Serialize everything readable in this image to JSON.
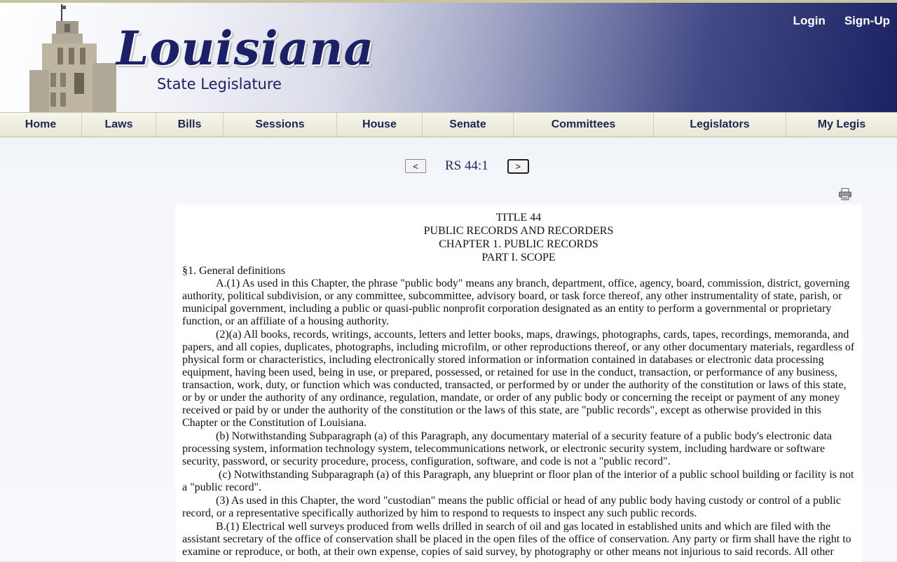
{
  "header": {
    "logo_title": "Louisiana",
    "logo_subtitle": "State Legislature",
    "login": "Login",
    "signup": "Sign-Up"
  },
  "nav": {
    "items": [
      "Home",
      "Laws",
      "Bills",
      "Sessions",
      "House",
      "Senate",
      "Committees",
      "Legislators",
      "My Legis"
    ]
  },
  "pager": {
    "prev": "<",
    "label": "RS 44:1",
    "next": ">"
  },
  "icons": {
    "print": "printer-icon"
  },
  "document": {
    "title": "TITLE 44",
    "subtitle": "PUBLIC RECORDS AND RECORDERS",
    "chapter": "CHAPTER 1. PUBLIC RECORDS",
    "part": "PART I. SCOPE",
    "section_heading": "§1. General definitions",
    "paragraphs": [
      "A.(1) As used in this Chapter, the phrase \"public body\" means any branch, department, office, agency, board, commission, district, governing authority, political subdivision, or any committee, subcommittee, advisory board, or task force thereof, any other instrumentality of state, parish, or municipal government, including a public or quasi-public nonprofit corporation designated as an entity to perform a governmental or proprietary function, or an affiliate of a housing authority.",
      "(2)(a) All books, records, writings, accounts, letters and letter books, maps, drawings, photographs, cards, tapes, recordings, memoranda, and papers, and all copies, duplicates, photographs, including microfilm, or other reproductions thereof, or any other documentary materials, regardless of physical form or characteristics, including electronically stored information or information contained in databases or electronic data processing equipment, having been used, being in use, or prepared, possessed, or retained for use in the conduct, transaction, or performance of any business, transaction, work, duty, or function which was conducted, transacted, or performed by or under the authority of the constitution or laws of this state, or by or under the authority of any ordinance, regulation, mandate, or order of any public body or concerning the receipt or payment of any money received or paid by or under the authority of the constitution or the laws of this state, are \"public records\", except as otherwise provided in this Chapter or the Constitution of Louisiana.",
      "(b) Notwithstanding Subparagraph (a) of this Paragraph, any documentary material of a security feature of a public body's electronic data processing system, information technology system, telecommunications network, or electronic security system, including hardware or software security, password, or security procedure, process, configuration, software, and code is not a \"public record\".",
      "(c) Notwithstanding Subparagraph (a) of this Paragraph, any blueprint or floor plan of the interior of a public school building or facility is not a \"public record\".",
      "(3) As used in this Chapter, the word \"custodian\" means the public official or head of any public body having custody or control of a public record, or a representative specifically authorized by him to respond to requests to inspect any such public records.",
      "B.(1) Electrical well surveys produced from wells drilled in search of oil and gas located in established units and which are filed with the assistant secretary of the office of conservation shall be placed in the open files of the office of conservation. Any party or firm shall have the right to examine or reproduce, or both, at their own expense, copies of said survey, by photography or other means not injurious to said records. All other"
    ]
  },
  "colors": {
    "header_dark": "#1b2262",
    "logo_text": "#1c2166",
    "nav_bg": "#efecdd",
    "nav_text": "#1b2553"
  }
}
